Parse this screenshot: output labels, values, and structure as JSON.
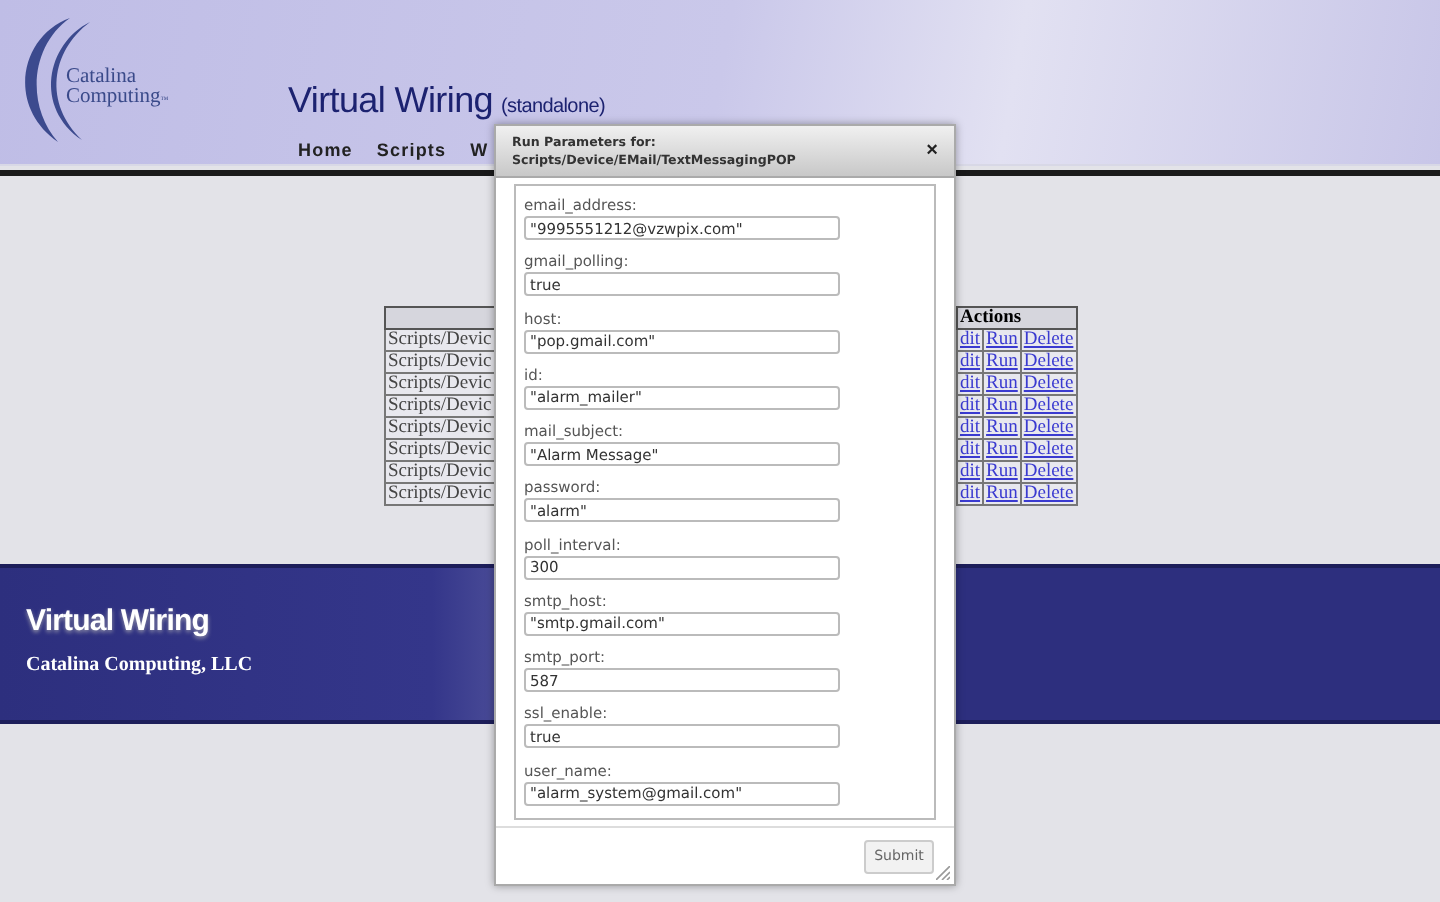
{
  "logo": {
    "text": "Catalina Computing",
    "mark": "™"
  },
  "header": {
    "title": "Virtual Wiring",
    "subtitle": "(standalone)"
  },
  "nav": [
    "Home",
    "Scripts",
    "W"
  ],
  "table": {
    "header": "Actions",
    "rows": [
      {
        "path": "Scripts/Devic",
        "edit": "dit",
        "run": "Run",
        "delete": "Delete"
      },
      {
        "path": "Scripts/Devic",
        "edit": "dit",
        "run": "Run",
        "delete": "Delete"
      },
      {
        "path": "Scripts/Devic",
        "edit": "dit",
        "run": "Run",
        "delete": "Delete"
      },
      {
        "path": "Scripts/Devic",
        "edit": "dit",
        "run": "Run",
        "delete": "Delete"
      },
      {
        "path": "Scripts/Devic",
        "edit": "dit",
        "run": "Run",
        "delete": "Delete"
      },
      {
        "path": "Scripts/Devic",
        "edit": "dit",
        "run": "Run",
        "delete": "Delete"
      },
      {
        "path": "Scripts/Devic",
        "edit": "dit",
        "run": "Run",
        "delete": "Delete"
      },
      {
        "path": "Scripts/Devic",
        "edit": "dit",
        "run": "Run",
        "delete": "Delete"
      }
    ]
  },
  "footer": {
    "title": "Virtual Wiring",
    "company": "Catalina Computing, LLC"
  },
  "dialog": {
    "title_line1": "Run Parameters for:",
    "title_line2": "Scripts/Device/EMail/TextMessagingPOP",
    "close": "×",
    "submit": "Submit",
    "params": [
      {
        "label": "email_address:",
        "value": "\"9995551212@vzwpix.com\""
      },
      {
        "label": "gmail_polling:",
        "value": "true"
      },
      {
        "label": "host:",
        "value": "\"pop.gmail.com\""
      },
      {
        "label": "id:",
        "value": "\"alarm_mailer\""
      },
      {
        "label": "mail_subject:",
        "value": "\"Alarm Message\""
      },
      {
        "label": "password:",
        "value": "\"alarm\""
      },
      {
        "label": "poll_interval:",
        "value": "300"
      },
      {
        "label": "smtp_host:",
        "value": "\"smtp.gmail.com\""
      },
      {
        "label": "smtp_port:",
        "value": "587"
      },
      {
        "label": "ssl_enable:",
        "value": "true"
      },
      {
        "label": "user_name:",
        "value": "\"alarm_system@gmail.com\""
      }
    ]
  }
}
